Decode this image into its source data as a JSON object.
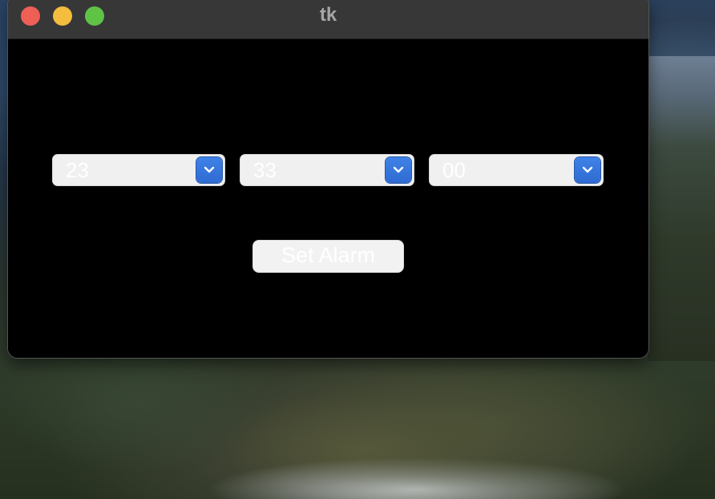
{
  "window": {
    "title": "tk"
  },
  "alarm": {
    "hour": "23",
    "minute": "33",
    "second": "00",
    "button_label": "Set Alarm"
  },
  "colors": {
    "accent": "#2f6bd2",
    "window_bg": "#000000",
    "titlebar": "#373737"
  }
}
